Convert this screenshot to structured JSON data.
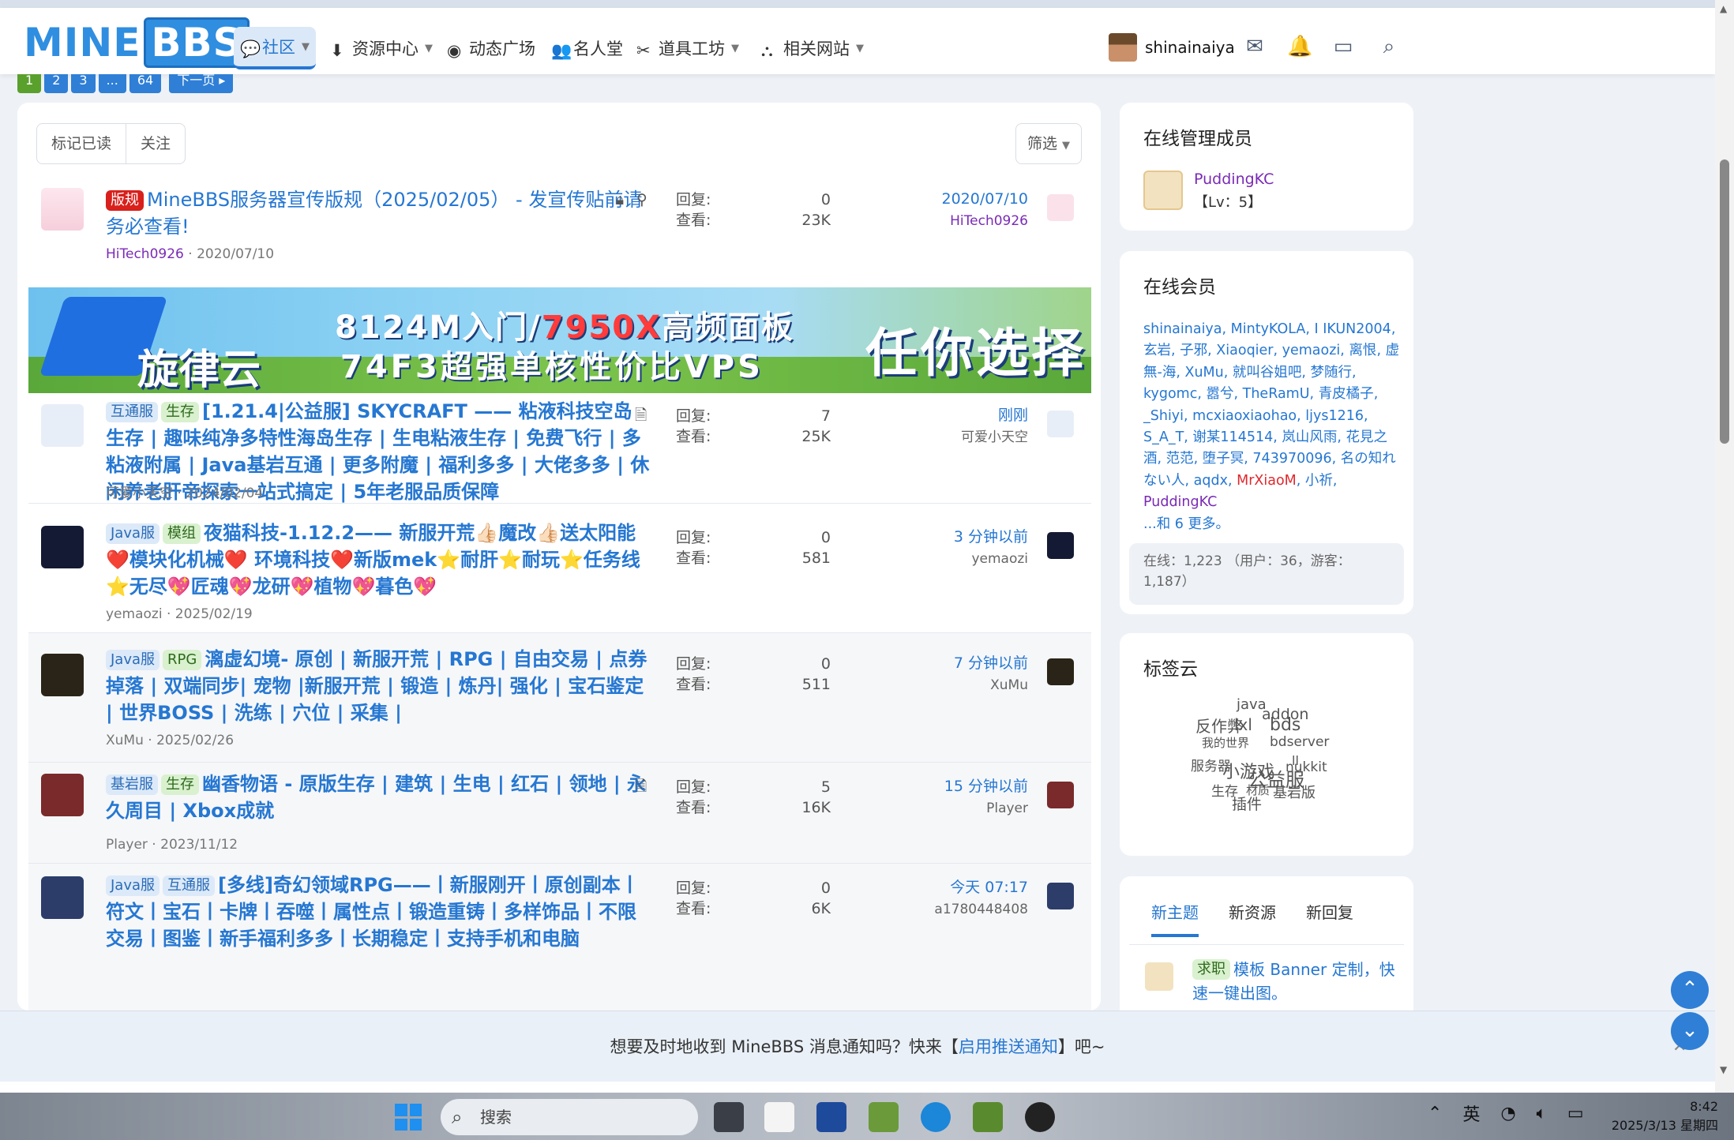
{
  "header": {
    "nav": [
      {
        "label": "社区",
        "active": true
      },
      {
        "label": "资源中心"
      },
      {
        "label": "动态广场"
      },
      {
        "label": "名人堂"
      },
      {
        "label": "道具工坊"
      },
      {
        "label": "相关网站"
      }
    ],
    "username": "shinainaiya"
  },
  "pager": [
    "1",
    "2",
    "3",
    "...",
    "64",
    "下一页 ▸"
  ],
  "toolbar": {
    "mark_read": "标记已读",
    "watch": "关注",
    "filter": "筛选"
  },
  "threads": [
    {
      "prefix": "版规",
      "title": "MineBBS服务器宣传版规（2025/02/05） - 发宣传贴前请务必查看!",
      "author": "HiTech0926",
      "date": "2020/07/10",
      "replies_label": "回复:",
      "replies": "0",
      "views_label": "查看:",
      "views": "23K",
      "last_time": "2020/07/10",
      "last_user": "HiTech0926"
    },
    {
      "prefix1": "互通服",
      "prefix2": "生存",
      "title": "[1.21.4|公益服] SKYCRAFT —— 粘液科技空岛生存 | 趣味纯净多特性海岛生存 | 生电粘液生存 | 免费飞行 | 多粘液附属 | Java基岩互通 | 更多附魔 | 福利多多 | 大佬多多 | 休闲养老肝帝探索一站式搞定 | 5年老服品质保障",
      "author": "可爱小天空",
      "date": "2024/02/04",
      "replies": "7",
      "views": "25K",
      "last_time": "刚刚",
      "last_user": "可爱小天空"
    },
    {
      "prefix1": "Java服",
      "prefix2": "模组",
      "title": "夜猫科技-1.12.2—— 新服开荒👍🏻魔改👍🏻送太阳能❤️模块化机械❤️ 环境科技❤️新版mek⭐耐肝⭐耐玩⭐任务线⭐无尽💖匠魂💖龙研💖植物💖暮色💖",
      "author": "yemaozi",
      "date": "2025/02/19",
      "replies": "0",
      "views": "581",
      "last_time": "3 分钟以前",
      "last_user": "yemaozi"
    },
    {
      "prefix1": "Java服",
      "prefix2": "RPG",
      "title": "漓虚幻境- 原创 | 新服开荒 | RPG | 自由交易 | 点券掉落 | 双端同步| 宠物 |新服开荒 | 锻造 | 炼丹| 强化 | 宝石鉴定 | 世界BOSS | 洗练 | 穴位 | 采集 |",
      "author": "XuMu",
      "date": "2025/02/26",
      "replies": "0",
      "views": "511",
      "last_time": "7 分钟以前",
      "last_user": "XuMu"
    },
    {
      "prefix1": "基岩服",
      "prefix2": "生存",
      "title": "幽香物语 - 原版生存 | 建筑 | 生电 | 红石 | 领地 | 永久周目 | Xbox成就",
      "author": "Player",
      "date": "2023/11/12",
      "replies": "5",
      "views": "16K",
      "last_time": "15 分钟以前",
      "last_user": "Player"
    },
    {
      "prefix1": "Java服",
      "prefix2": "互通服",
      "title": "[多线]奇幻领域RPG——丨新服刚开丨原创副本丨符文丨宝石丨卡牌丨吞噬丨属性点丨锻造重铸丨多样饰品丨不限交易丨图鉴丨新手福利多多丨长期稳定丨支持手机和电脑",
      "author": "a1780448408",
      "date": "",
      "replies": "0",
      "views": "6K",
      "last_time": "今天 07:17",
      "last_user": "a1780448408"
    }
  ],
  "banner": {
    "brand": "旋律云",
    "line1a": "8124M入门/",
    "line1b": "7950X",
    "line1c": "高频面板",
    "line2": "74F3超强单核性价比VPS",
    "slogan": "任你选择"
  },
  "staff": {
    "title": "在线管理成员",
    "name": "PuddingKC",
    "level": "【Lv：5】"
  },
  "members": {
    "title": "在线会员",
    "names": [
      "shinainaiya",
      "MintyKOLA",
      "I IKUN2004",
      "玄岩",
      "子邪",
      "Xiaoqier",
      "yemaozi",
      "离恨",
      "虚無-海",
      "XuMu",
      "就叫谷姐吧",
      "梦随行",
      "kygomc",
      "嚣兮",
      "TheRamU",
      "青皮橘子",
      "_Shiyi",
      "mcxiaoxiaohao",
      "ljys1216",
      "S_A_T",
      "谢某114514",
      "岚山风雨",
      "花見之酒",
      "范范",
      "堕子冥",
      "743970096",
      "名の知れない人",
      "aqdx",
      "MrXiaoM",
      "小祈",
      "PuddingKC"
    ],
    "more": "...和 6 更多。",
    "stats": "在线：1,223 （用户：36，游客：1,187）"
  },
  "tags": {
    "title": "标签云",
    "words": [
      "java",
      "addon",
      "反作弊",
      "lxl",
      "bds",
      "我的世界",
      "bdserver",
      "服务器",
      "小游戏",
      "公益服",
      "nukkit",
      "ll",
      "生存",
      "材质",
      "基岩版",
      "插件"
    ]
  },
  "newtabs": {
    "tabs": [
      "新主题",
      "新资源",
      "新回复"
    ],
    "item_prefix": "求职",
    "item_title": "模板 Banner 定制，快速一键出图。"
  },
  "notify": {
    "text_a": "想要及时地收到 MineBBS 消息通知吗？快来【",
    "link": "启用推送通知",
    "text_b": "】吧~"
  },
  "taskbar": {
    "search_placeholder": "搜索",
    "ime": "英",
    "time": "8:42",
    "date": "2025/3/13 星期四"
  },
  "colors": {
    "accent": "#2577d2",
    "brand": "#2f8ee0",
    "prefix_red": "#d8201c",
    "user_purple": "#7a2ab6"
  }
}
